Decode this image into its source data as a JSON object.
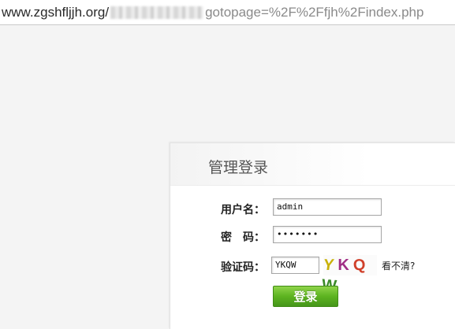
{
  "browser": {
    "url_prefix": "www.zgshfljjh.org/",
    "url_suffix": "gotopage=%2F%2Ffjh%2Findex.php"
  },
  "login": {
    "title": "管理登录",
    "username_label": "用户名：",
    "username_value": "admin",
    "password_label": "密　码：",
    "password_value": "•••••••",
    "captcha_label": "验证码：",
    "captcha_value": "YKQW",
    "captcha_image_text": [
      "Y",
      "K",
      "Q",
      "W"
    ],
    "refresh_link": "看不清?",
    "submit_label": "登录"
  },
  "colors": {
    "button_green": "#5db320",
    "captcha_colors": [
      "#c9b20a",
      "#a02d84",
      "#d0402a",
      "#3c8a2a"
    ]
  }
}
